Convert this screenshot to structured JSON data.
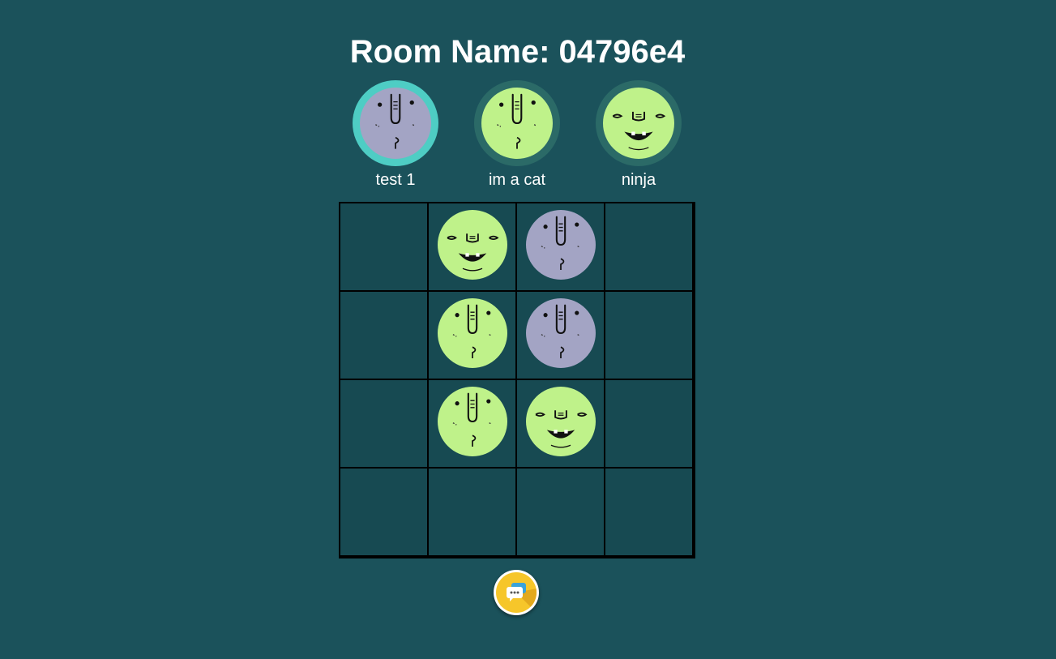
{
  "room": {
    "label": "Room Name: 04796e4"
  },
  "colors": {
    "background": "#1b525b",
    "board_lines": "#000000",
    "active_ring": "#4ecdc4",
    "inactive_ring": "#2b6a67",
    "face_purple": "#a3a4c4",
    "face_green": "#bff28a",
    "chat_yellow": "#f6c62a"
  },
  "players": [
    {
      "name": "test 1",
      "face": "long-nose",
      "color": "purple",
      "active": true
    },
    {
      "name": "im a cat",
      "face": "long-nose",
      "color": "green",
      "active": false
    },
    {
      "name": "ninja",
      "face": "grin",
      "color": "green",
      "active": false
    }
  ],
  "board": {
    "rows": 4,
    "cols": 4,
    "cells": [
      [
        null,
        {
          "face": "grin",
          "color": "green"
        },
        {
          "face": "long-nose",
          "color": "purple"
        },
        null
      ],
      [
        null,
        {
          "face": "long-nose",
          "color": "green"
        },
        {
          "face": "long-nose",
          "color": "purple"
        },
        null
      ],
      [
        null,
        {
          "face": "long-nose",
          "color": "green"
        },
        {
          "face": "grin",
          "color": "green"
        },
        null
      ],
      [
        null,
        null,
        null,
        null
      ]
    ]
  },
  "chat": {
    "icon": "chat-bubbles-icon"
  }
}
